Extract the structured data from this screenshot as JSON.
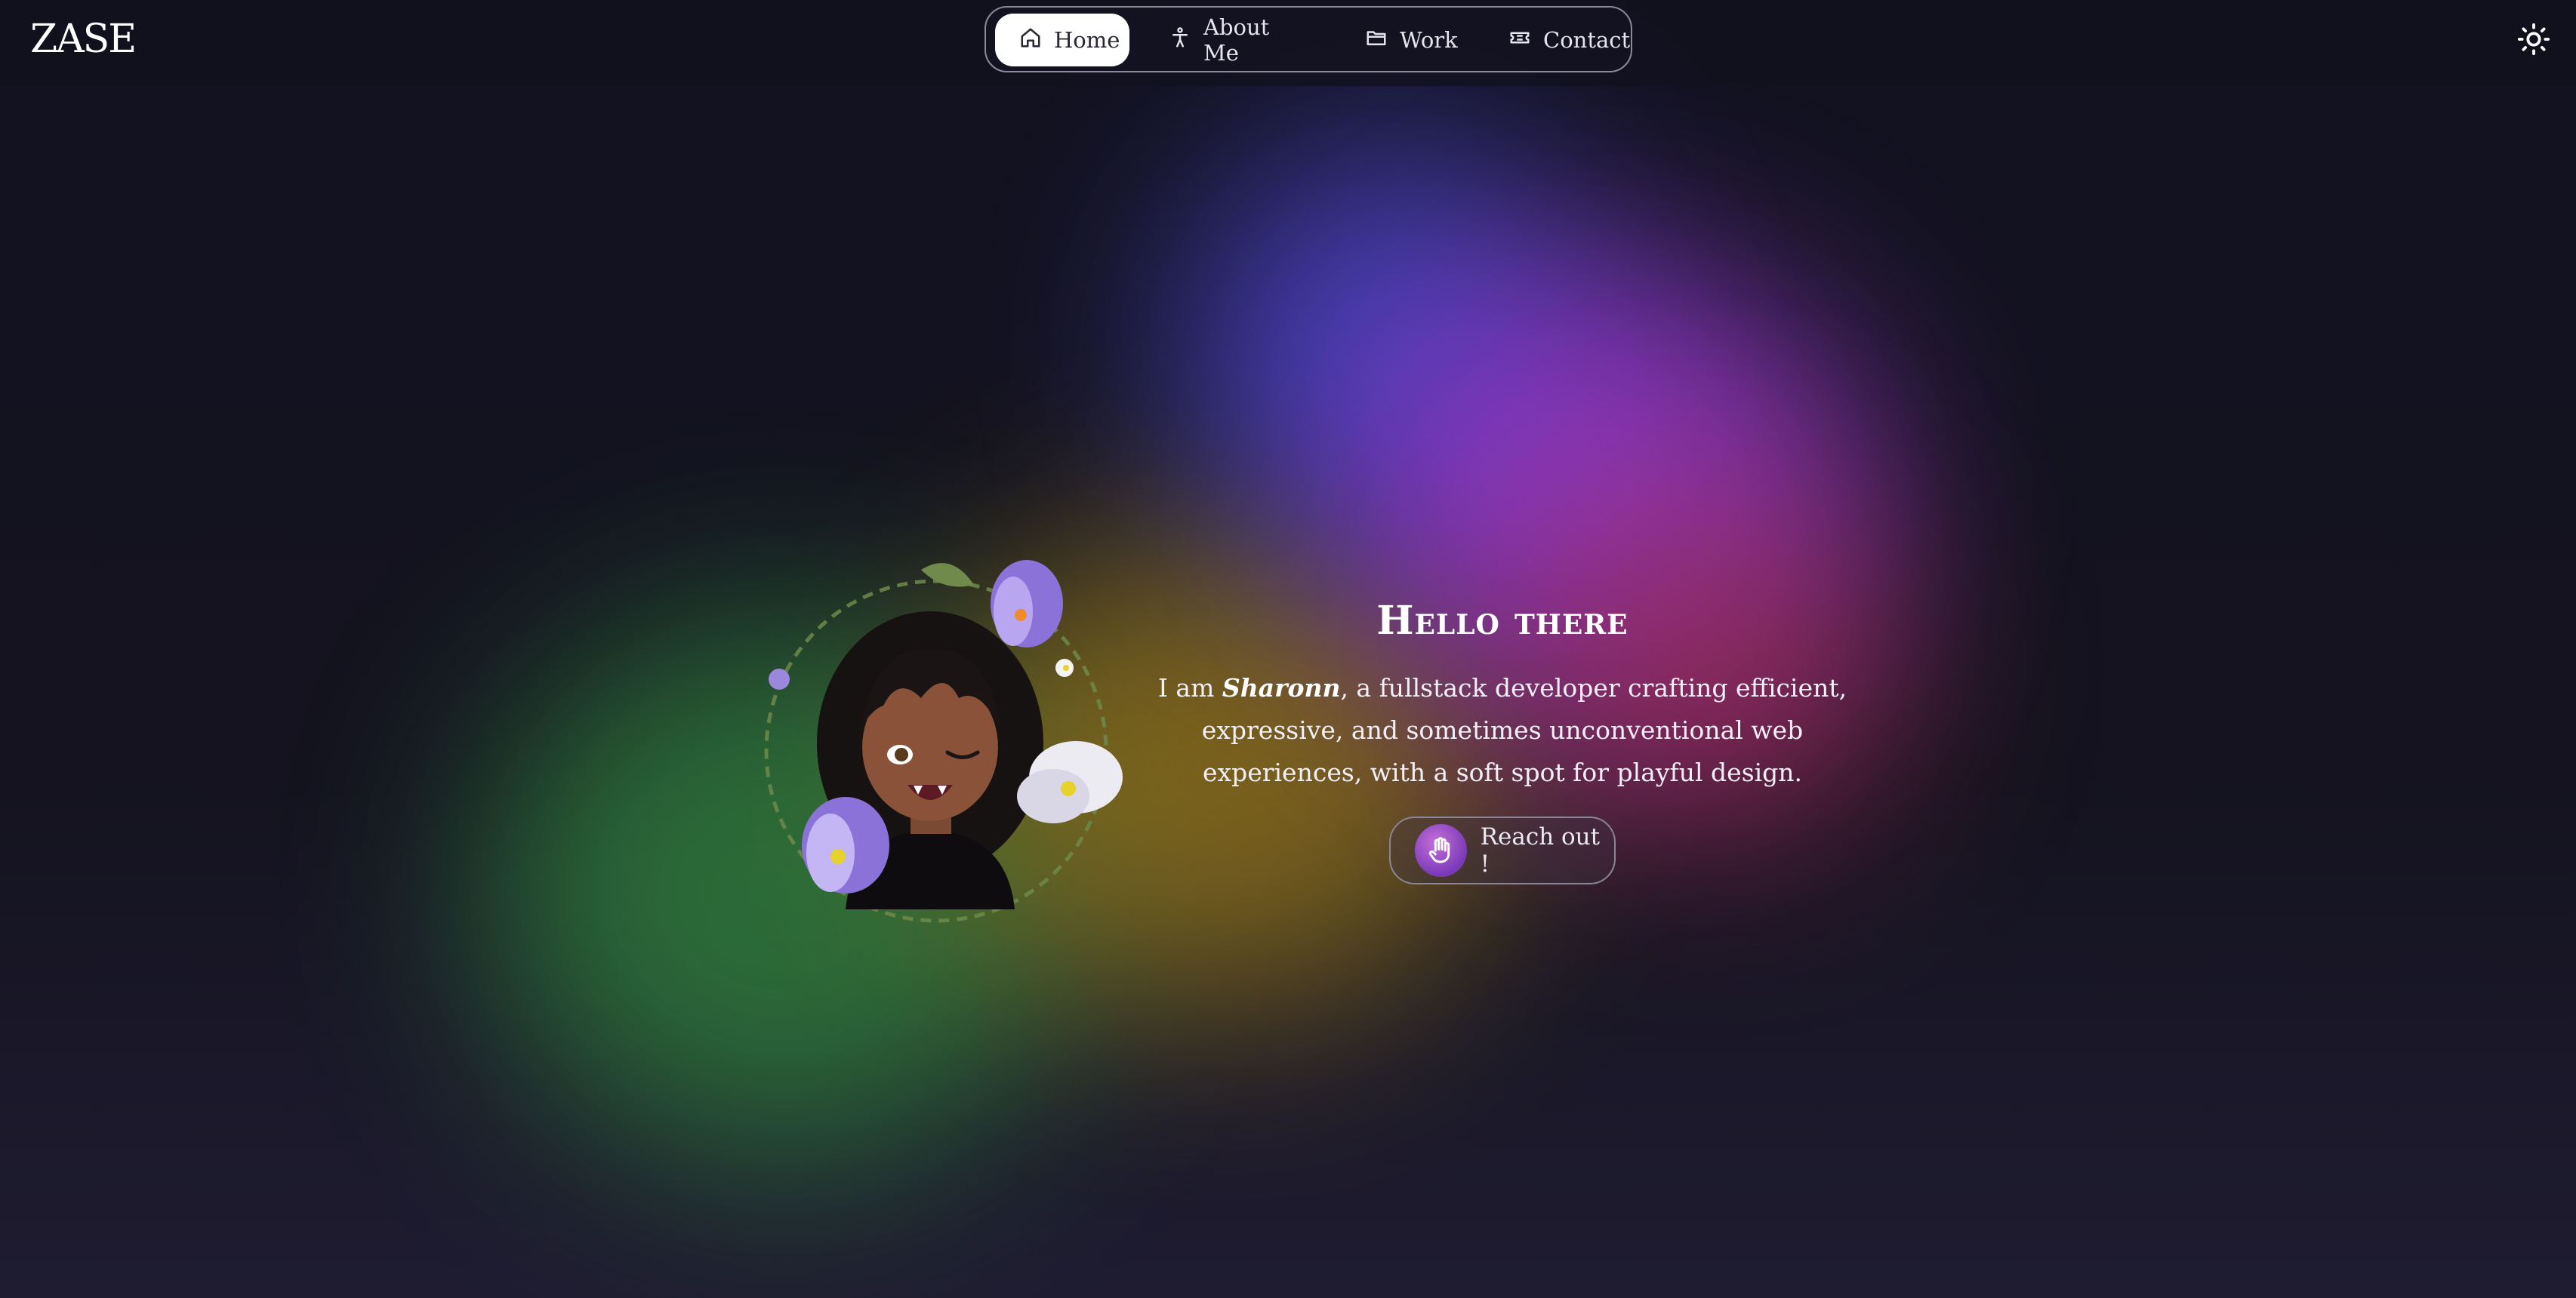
{
  "header": {
    "logo_text": "ZASE",
    "nav": [
      {
        "label": "Home",
        "icon": "home-icon",
        "active": true
      },
      {
        "label": "About Me",
        "icon": "person-icon",
        "active": false
      },
      {
        "label": "Work",
        "icon": "folder-icon",
        "active": false
      },
      {
        "label": "Contact",
        "icon": "ticket-icon",
        "active": false
      }
    ],
    "theme_toggle_icon": "sun-icon"
  },
  "hero": {
    "title": "Hello there",
    "intro_prefix": "I am ",
    "name": "Sharonn",
    "intro_suffix": ", a fullstack developer crafting efficient, expressive, and sometimes unconventional web experiences, with a soft spot for playful design.",
    "cta_label": "Reach out !",
    "cta_icon": "hand-icon",
    "avatar_icon": "avatar-illustration"
  },
  "colors": {
    "background": "#13121f",
    "accent_purple": "#9a3ad0",
    "accent_blue": "#4a45c9",
    "accent_green": "#2f7a3c",
    "accent_gold": "#9a7a1c"
  }
}
